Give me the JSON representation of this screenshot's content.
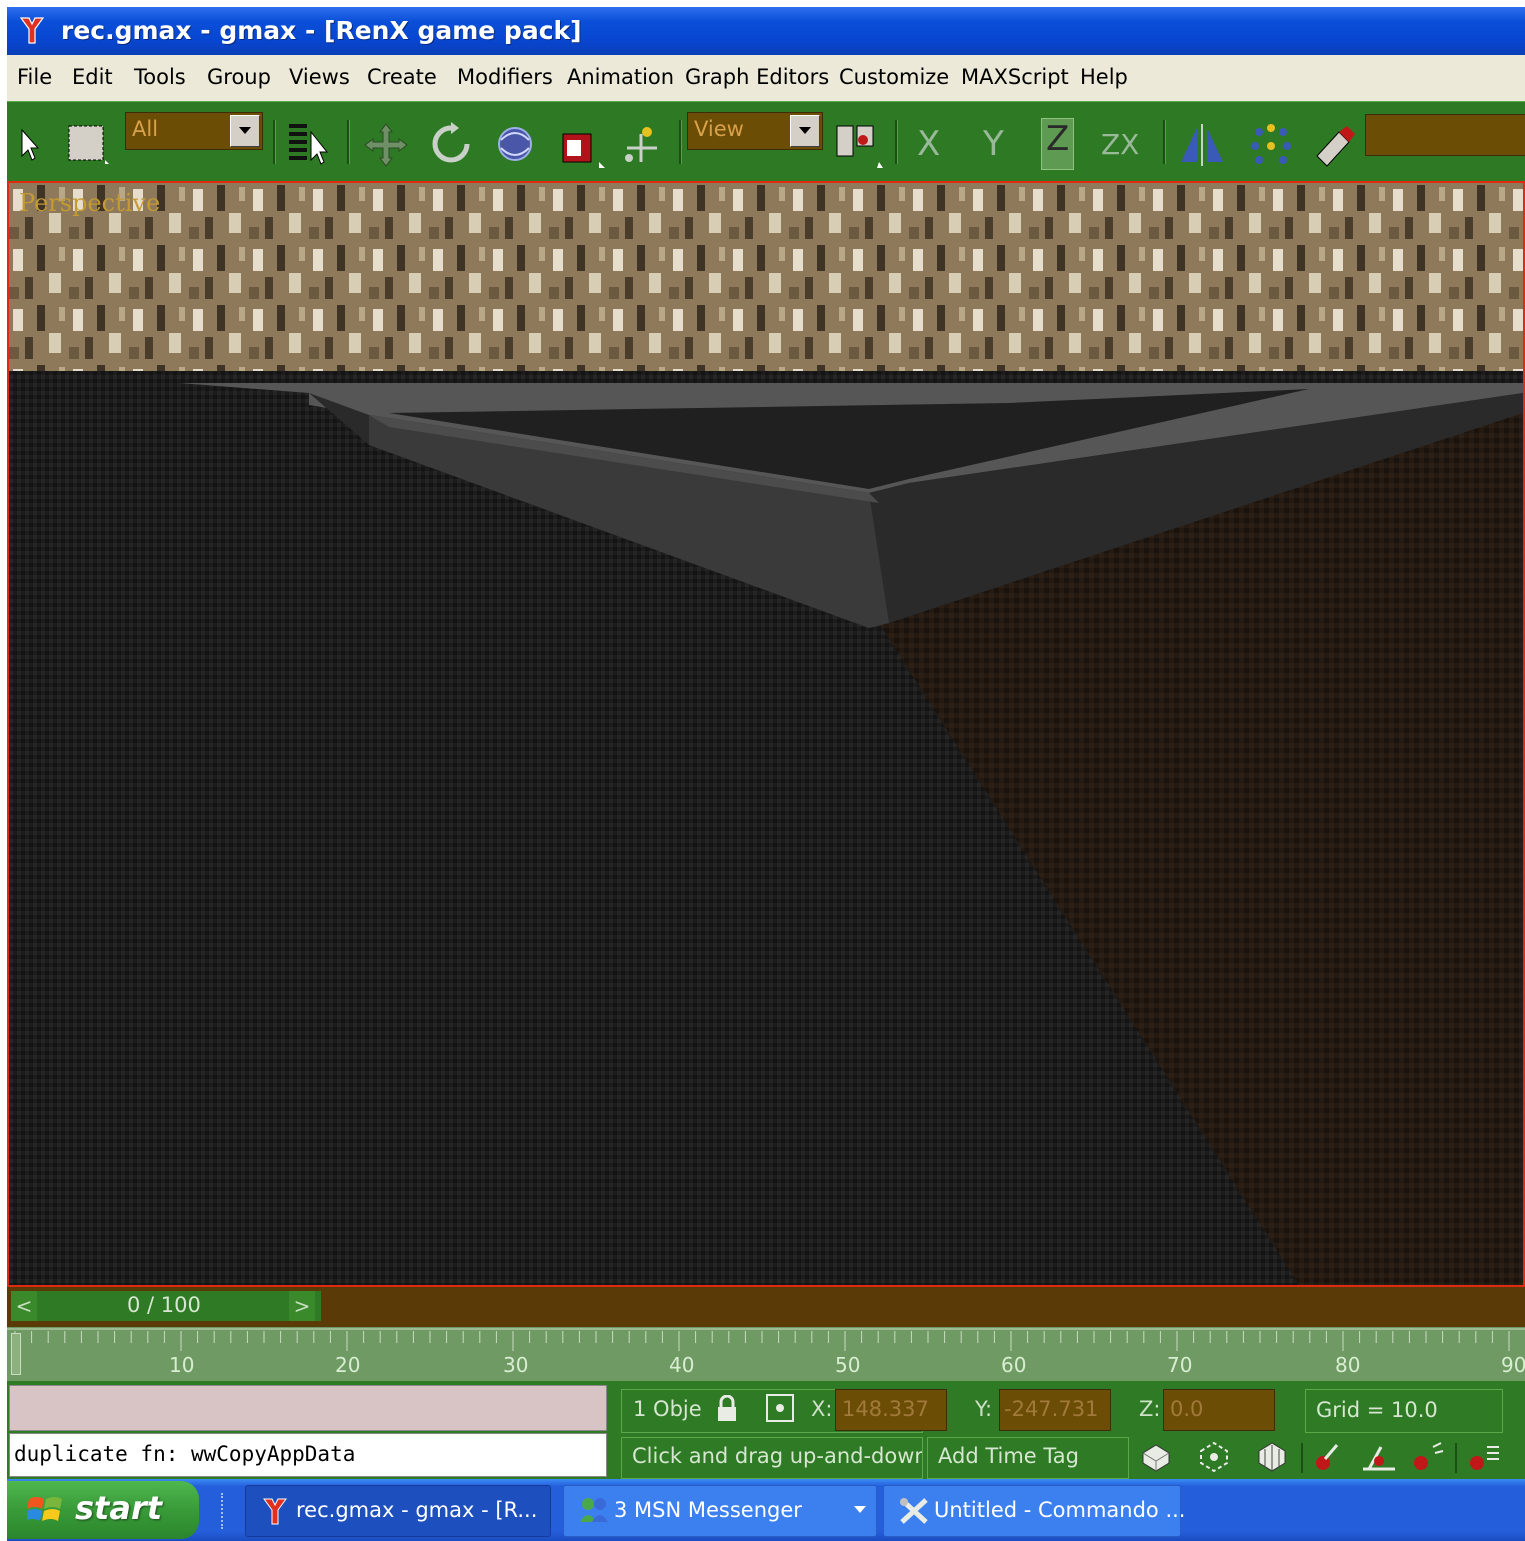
{
  "window": {
    "title": "rec.gmax - gmax - [RenX game pack]"
  },
  "menu": [
    "File",
    "Edit",
    "Tools",
    "Group",
    "Views",
    "Create",
    "Modifiers",
    "Animation",
    "Graph Editors",
    "Customize",
    "MAXScript",
    "Help"
  ],
  "toolbar": {
    "selection_filter": "All",
    "reference_coord": "View",
    "axis_labels": [
      "X",
      "Y",
      "Z",
      "ZX"
    ],
    "active_axis": "Z",
    "icons": [
      "select-arrow-icon",
      "region-select-icon",
      "select-by-name-icon",
      "move-icon",
      "rotate-icon",
      "orbit-icon",
      "scale-icon",
      "link-icon",
      "pivot-icon",
      "mirror-icon",
      "array-icon",
      "align-icon"
    ]
  },
  "viewport": {
    "label": "Perspective"
  },
  "timeslider": {
    "frame_label": "0 / 100",
    "prev_arrow": "<",
    "next_arrow": ">"
  },
  "trackbar": {
    "ticks": [
      "10",
      "20",
      "30",
      "40",
      "50",
      "60",
      "70",
      "80",
      "90"
    ]
  },
  "status": {
    "listener_output": "duplicate fn: wwCopyAppData",
    "selection_count": "1 Obje",
    "x_label": "X:",
    "x_value": "148.337",
    "y_label": "Y:",
    "y_value": "-247.731",
    "z_label": "Z:",
    "z_value": "0.0",
    "grid": "Grid = 10.0",
    "prompt": "Click and drag up-and-down tc",
    "add_time_tag": "Add Time Tag"
  },
  "taskbar": {
    "start_label": "start",
    "tasks": [
      {
        "label": "rec.gmax - gmax - [R...",
        "icon": "gmax-icon"
      },
      {
        "label": "3 MSN Messenger",
        "icon": "msn-icon"
      },
      {
        "label": "Untitled - Commando ...",
        "icon": "tools-icon"
      }
    ]
  },
  "colors": {
    "titlebar": "#0a4fd8",
    "toolbar": "#2e7a24",
    "viewport_border": "#e02a12",
    "field_brown": "#6b4d06"
  }
}
